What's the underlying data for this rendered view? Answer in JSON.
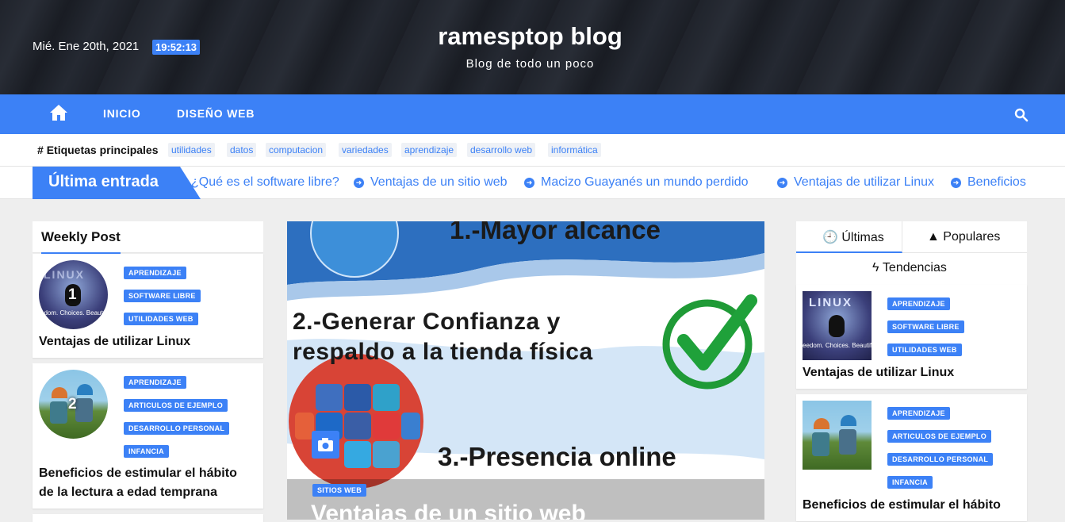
{
  "header": {
    "date": "Mié. Ene 20th, 2021",
    "time": "19:52:13",
    "site_title": "ramesptop blog",
    "site_description": "Blog de todo un poco"
  },
  "nav": {
    "home_icon": "home-icon",
    "items": [
      {
        "label": "INICIO"
      },
      {
        "label": "DISEÑO WEB"
      }
    ],
    "search_icon": "search-icon"
  },
  "tags": {
    "title": "Etiquetas principales",
    "items": [
      "utilidades",
      "datos",
      "computacion",
      "variedades",
      "aprendizaje",
      "desarrollo web",
      "informática"
    ]
  },
  "latest": {
    "label": "Última entrada",
    "items": [
      "¿Qué es el software libre?",
      "Ventajas de un sitio web",
      "Macizo Guayanés un mundo perdido",
      "Ventajas de utilizar Linux",
      "Beneficios"
    ]
  },
  "weekly": {
    "title": "Weekly Post",
    "posts": [
      {
        "num": "1",
        "cats": [
          "APRENDIZAJE",
          "SOFTWARE LIBRE",
          "UTILIDADES WEB"
        ],
        "title": "Ventajas de utilizar Linux",
        "thumb_text": "LINUX",
        "thumb_caption": "edom. Choices. Beauty"
      },
      {
        "num": "2",
        "cats": [
          "APRENDIZAJE",
          "ARTICULOS DE EJEMPLO",
          "DESARROLLO PERSONAL",
          "INFANCIA"
        ],
        "title_line1": "Beneficios de estimular el hábito",
        "title_line2": "de la lectura a edad temprana"
      }
    ]
  },
  "hero": {
    "line1": "1.-Mayor alcance",
    "line2a": "2.-Generar Confianza y",
    "line2b": "respaldo a la tienda física",
    "line3": "3.-Presencia online",
    "category": "SITIOS WEB",
    "title": "Ventajas de un sitio web",
    "camera_icon": "camera-icon"
  },
  "sidebar": {
    "tabs": [
      "Últimas",
      "Populares",
      "Tendencias"
    ],
    "posts": [
      {
        "cats": [
          "APRENDIZAJE",
          "SOFTWARE LIBRE",
          "UTILIDADES WEB"
        ],
        "title": "Ventajas de utilizar Linux",
        "thumb_text": "LINUX",
        "thumb_caption": "eedom. Choices. Beautif"
      },
      {
        "cats": [
          "APRENDIZAJE",
          "ARTICULOS DE EJEMPLO",
          "DESARROLLO PERSONAL",
          "INFANCIA"
        ],
        "title": "Beneficios de estimular el hábito"
      }
    ]
  },
  "colors": {
    "accent": "#3c81f6",
    "background": "#eeeeee"
  }
}
